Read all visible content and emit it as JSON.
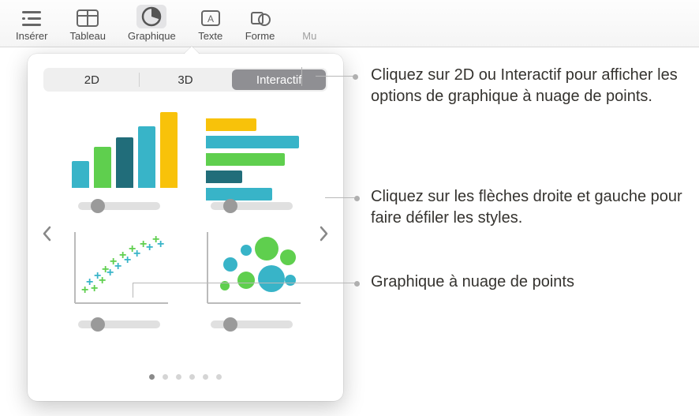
{
  "toolbar": {
    "items": [
      {
        "label": "Insérer"
      },
      {
        "label": "Tableau"
      },
      {
        "label": "Graphique"
      },
      {
        "label": "Texte"
      },
      {
        "label": "Forme"
      },
      {
        "label": "Mu"
      }
    ]
  },
  "popover": {
    "tabs": {
      "t0": "2D",
      "t1": "3D",
      "t2": "Interactif"
    },
    "colors": {
      "blue": "#38b4c8",
      "green": "#5fcf4e",
      "yellow": "#f8c20a",
      "dark": "#216d7a"
    },
    "pager_count": 6
  },
  "callouts": {
    "c1": "Cliquez sur 2D ou Interactif pour afficher les options de graphique à nuage de points.",
    "c2": "Cliquez sur les flèches droite et gauche pour faire défiler les styles.",
    "c3": "Graphique à nuage de points"
  }
}
